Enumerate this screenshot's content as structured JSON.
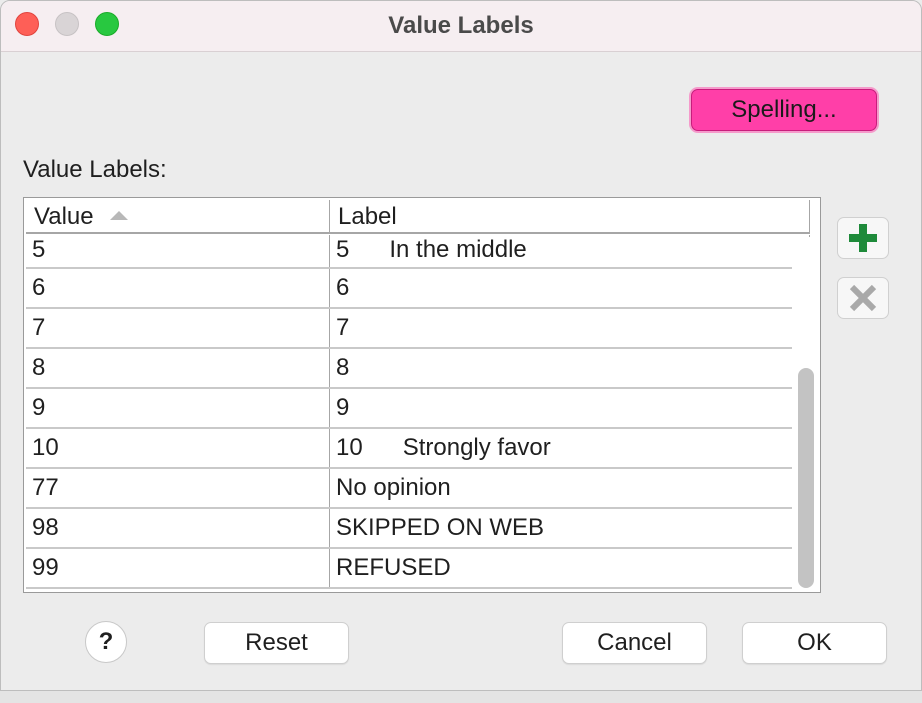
{
  "window": {
    "title": "Value Labels",
    "traffic_lights": [
      "close",
      "minimize",
      "maximize"
    ]
  },
  "spelling_button": "Spelling...",
  "section_label": "Value Labels:",
  "table": {
    "headers": {
      "value": "Value",
      "label": "Label"
    },
    "sort_indicator": "sort-ascending-icon",
    "rows": [
      {
        "value": "5",
        "label": "5      In the middle"
      },
      {
        "value": "6",
        "label": "6"
      },
      {
        "value": "7",
        "label": "7"
      },
      {
        "value": "8",
        "label": "8"
      },
      {
        "value": "9",
        "label": "9"
      },
      {
        "value": "10",
        "label": "10      Strongly favor"
      },
      {
        "value": "77",
        "label": "No opinion"
      },
      {
        "value": "98",
        "label": "SKIPPED ON WEB"
      },
      {
        "value": "99",
        "label": "REFUSED"
      }
    ]
  },
  "side_buttons": {
    "add": "plus-icon",
    "delete": "x-icon"
  },
  "footer": {
    "help": "?",
    "reset": "Reset",
    "cancel": "Cancel",
    "ok": "OK"
  },
  "colors": {
    "accent_button": "#ff3fa8",
    "add_icon": "#1e8a3a"
  }
}
